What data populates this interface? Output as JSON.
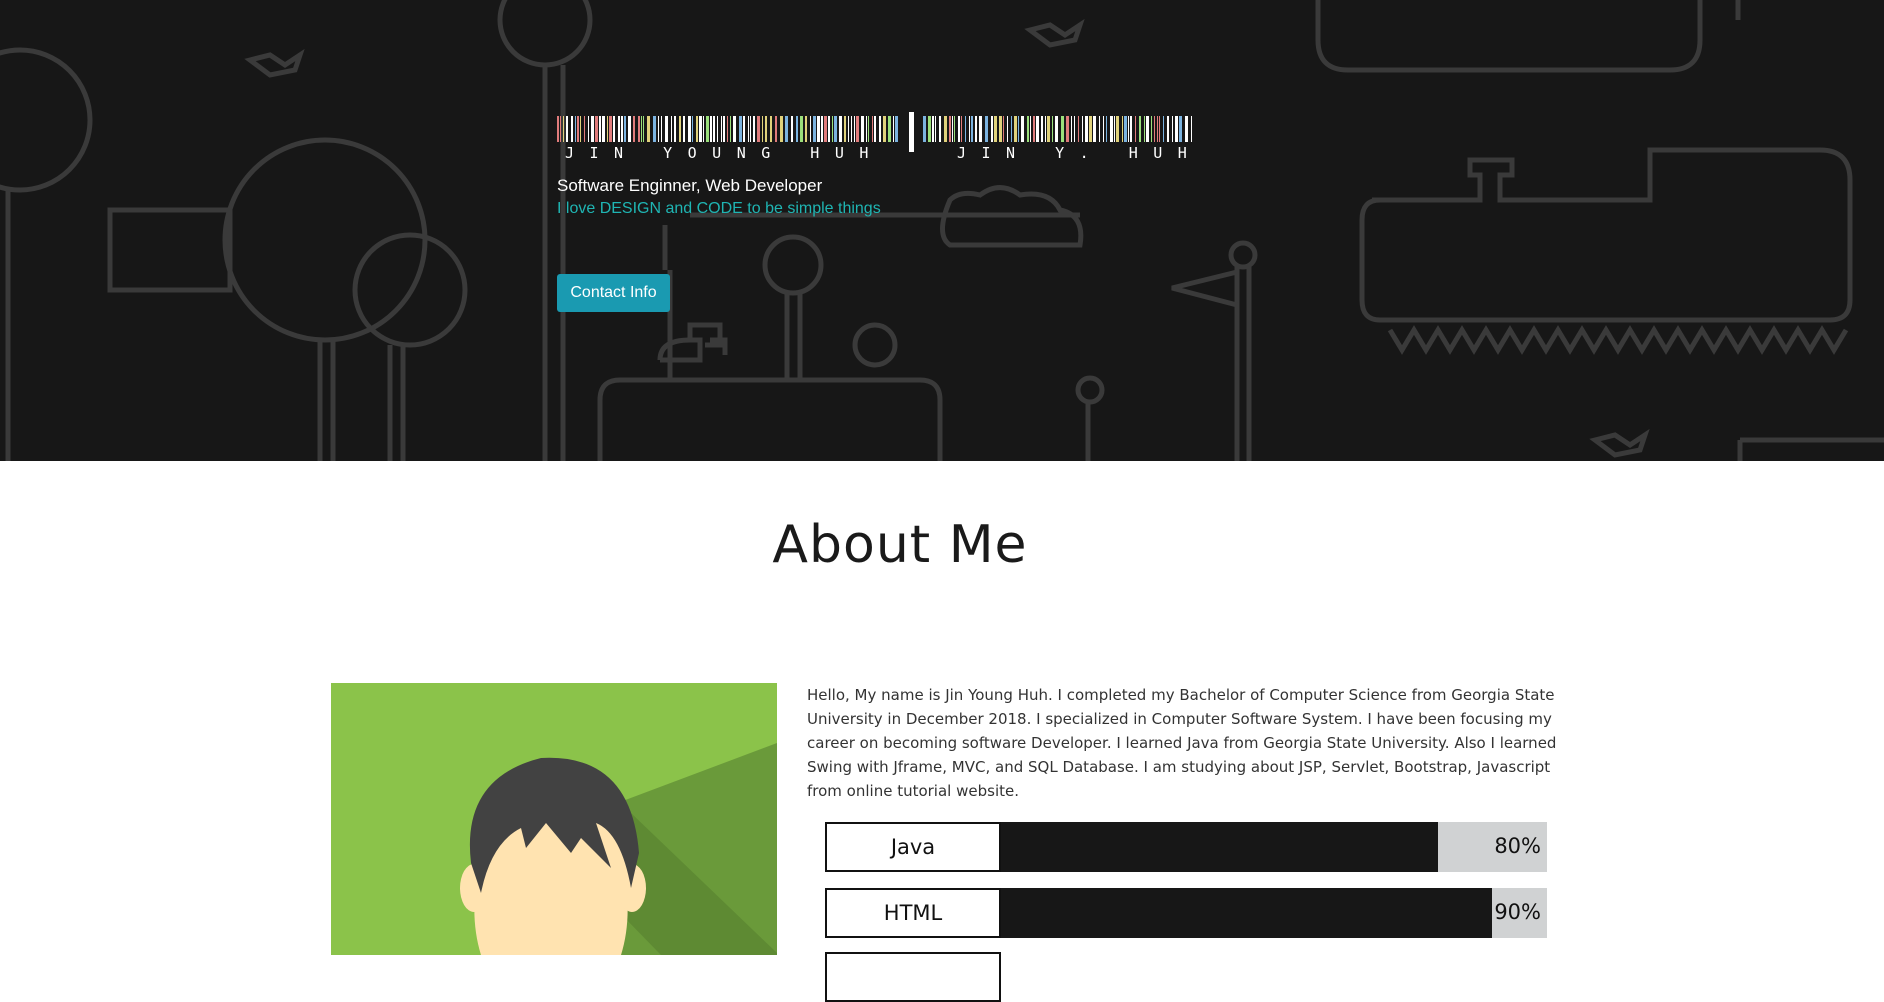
{
  "hero": {
    "barcode_caption_1": "JIN YOUNG HUH",
    "barcode_caption_2": "JIN Y. HUH",
    "subtitle": "Software Enginner, Web Developer",
    "tagline": "I love DESIGN and CODE to be simple things",
    "contact_button": "Contact Info"
  },
  "about": {
    "title": "About Me",
    "bio": "Hello, My name is Jin Young Huh. I completed my Bachelor of Computer Science from Georgia State University in December 2018. I specialized in Computer Software System. I have been focusing my career on becoming software Developer. I learned Java from Georgia State University. Also I learned Swing with Jframe, MVC, and SQL Database. I am studying about JSP, Servlet, Bootstrap, Javascript from online tutorial website.",
    "skills": [
      {
        "name": "Java",
        "percent_label": "80%",
        "level": 0.8
      },
      {
        "name": "HTML",
        "percent_label": "90%",
        "level": 0.9
      }
    ]
  },
  "colors": {
    "hero_bg": "#171717",
    "accent_text": "#1fb5b3",
    "button_bg": "#1a9ab1",
    "avatar_bg": "#8bc34a"
  }
}
